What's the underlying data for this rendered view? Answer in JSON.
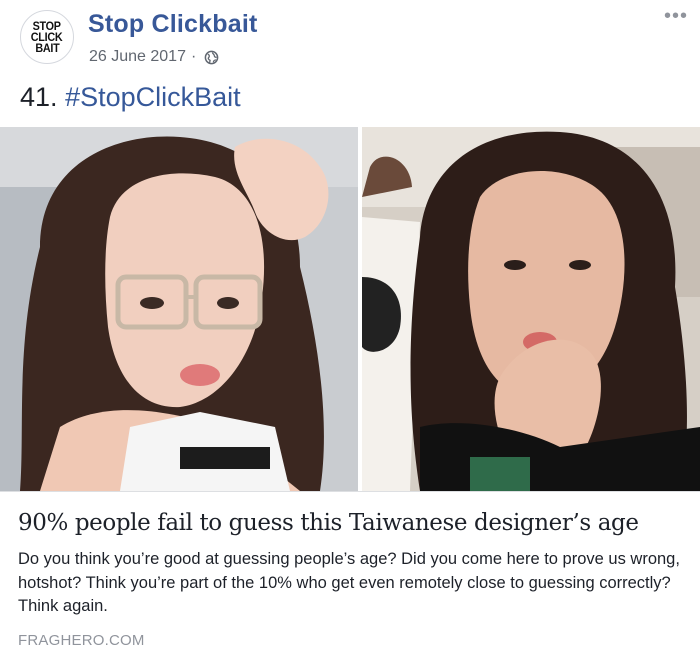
{
  "header": {
    "avatar_lines": [
      "STOP",
      "CLICK",
      "BAIT"
    ],
    "page_name": "Stop Clickbait",
    "date": "26 June 2017",
    "separator": "·",
    "privacy_icon": "globe-icon",
    "more_icon": "more-options-icon",
    "more_glyph": "•••"
  },
  "post": {
    "number": "41.",
    "hashtag": "#StopClickBait"
  },
  "link": {
    "title": "90% people fail to guess this Taiwanese designer’s age",
    "description": "Do you think you’re good at guessing people’s age? Did you come here to prove us wrong, hotshot? Think you’re part of the 10% who get even remotely close to guessing correctly? Think again.",
    "domain": "FRAGHERO.COM"
  },
  "colors": {
    "page_name": "#385898",
    "hashtag": "#365899",
    "meta": "#616770",
    "domain": "#90949c"
  }
}
